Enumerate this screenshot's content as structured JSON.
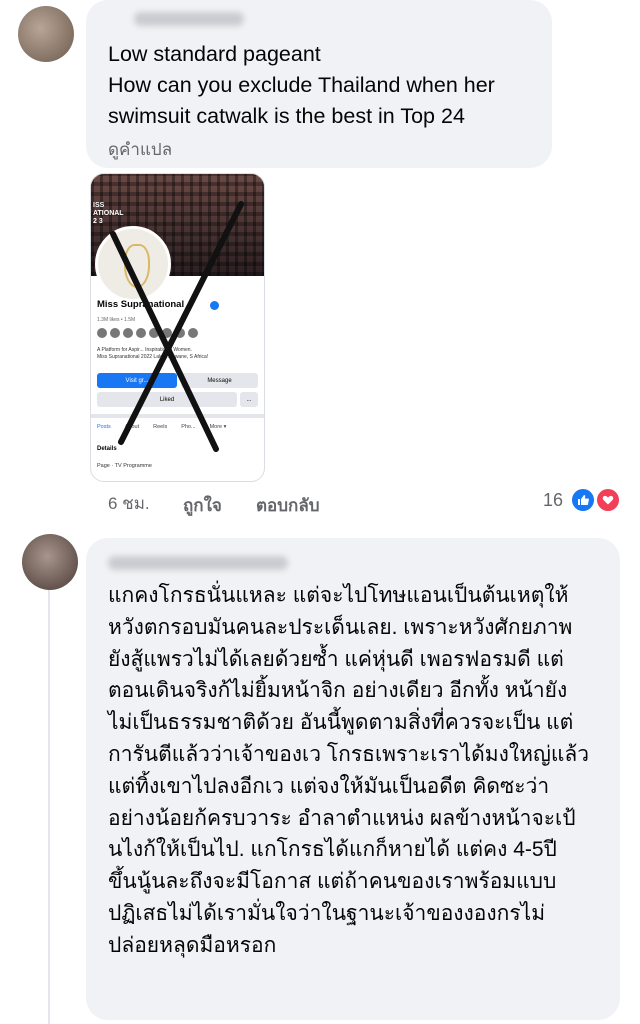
{
  "comment1": {
    "lines": "Low standard pageant\nHow can you exclude Thailand when her\nswimsuit catwalk is the best in Top 24",
    "translate": "ดูคำแปล",
    "time": "6 ชม.",
    "like": "ถูกใจ",
    "reply": "ตอบกลับ",
    "reaction_count": "16",
    "reaction_icons": [
      "thumbs-up-icon",
      "heart-icon"
    ]
  },
  "shared_screenshot": {
    "cover_title": "ISS\nATIONAL\n2 3",
    "page_name": "Miss Supranational",
    "stats": "1.3M likes  •  1.5M",
    "description": "A Platform for Aspir...  Inspirational Women.\nMiss Supranational 2022 Lalela Mswane, S Africa!",
    "visit_button": "Visit gr...",
    "message_button": "Message",
    "liked_button": "Liked",
    "more_button": "...",
    "tabs": [
      "Posts",
      "About",
      "Reels",
      "Pho...",
      "More ▾"
    ],
    "details": "Details",
    "page_type": "Page · TV Programme"
  },
  "comment2": {
    "lines": "แกคงโกรธนั่นแหละ แต่จะไปโทษแอนเป็นต้นเหตุให้\nหวังตกรอบมันคนละประเด็นเลย.  เพราะหวังศักยภาพ\nยังสู้แพรวไม่ได้เลยด้วยซ้ำ แค่หุ่นดี เพอรฟอรมดี แต่\nตอนเดินจริงก้ไม่ยิ้มหน้าจิก อย่างเดียว อีกทั้ง หน้ายัง\nไม่เป็นธรรมชาติด้วย  อันนี้พูดตามสิ่งที่ควรจะเป็น แต่\nการันตีแล้วว่าเจ้าของเว โกรธเพราะเราได้มงใหญ่แล้ว\nแต่ทิ้งเขาไปลงอีกเว แต่จงให้มันเป็นอดีต คิดซะว่า\nอย่างน้อยก้ครบวาระ อำลาตำแหน่ง ผลข้างหน้าจะเป้\nนไงก้ให้เป็นไป. แกโกรธได้แกก็หายได้ แต่คง 4-5ปี\nขึ้นนู้นละถึงจะมีโอกาส แต่ถ้าคนของเราพร้อมแบบ\nปฏิเสธไม่ได้เรามั่นใจว่าในฐานะเจ้าของงองกรไม่\nปล่อยหลุดมือหรอก"
  }
}
